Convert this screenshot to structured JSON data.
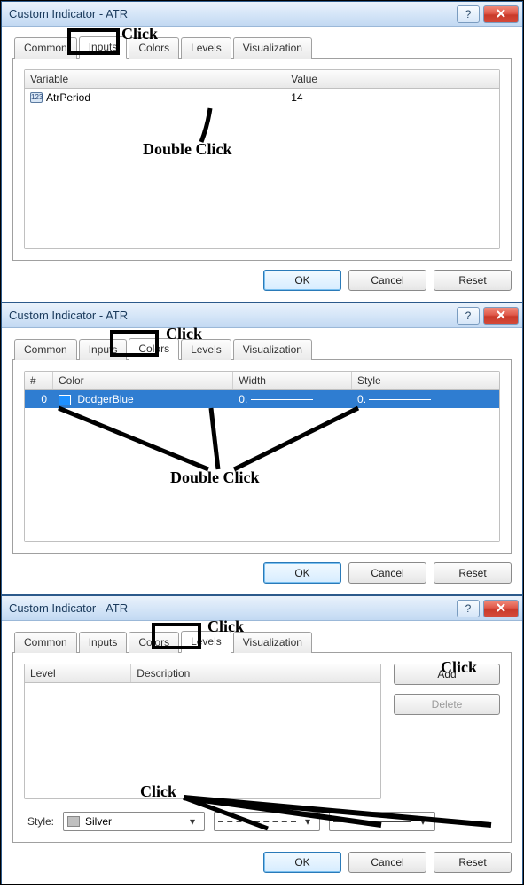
{
  "annotations": {
    "click": "Click",
    "double_click": "Double Click"
  },
  "dialogs": [
    {
      "title": "Custom Indicator - ATR",
      "tabs": [
        "Common",
        "Inputs",
        "Colors",
        "Levels",
        "Visualization"
      ],
      "active_tab": "Inputs",
      "inputs_table": {
        "columns": [
          "Variable",
          "Value"
        ],
        "rows": [
          {
            "icon": "int",
            "variable": "AtrPeriod",
            "value": "14"
          }
        ]
      },
      "buttons": {
        "ok": "OK",
        "cancel": "Cancel",
        "reset": "Reset"
      }
    },
    {
      "title": "Custom Indicator - ATR",
      "tabs": [
        "Common",
        "Inputs",
        "Colors",
        "Levels",
        "Visualization"
      ],
      "active_tab": "Colors",
      "colors_table": {
        "columns": [
          "#",
          "Color",
          "Width",
          "Style"
        ],
        "rows": [
          {
            "num": "0",
            "color": "DodgerBlue",
            "width": "0.",
            "style": "0."
          }
        ]
      },
      "buttons": {
        "ok": "OK",
        "cancel": "Cancel",
        "reset": "Reset"
      }
    },
    {
      "title": "Custom Indicator - ATR",
      "tabs": [
        "Common",
        "Inputs",
        "Colors",
        "Levels",
        "Visualization"
      ],
      "active_tab": "Levels",
      "levels_table": {
        "columns": [
          "Level",
          "Description"
        ]
      },
      "right_buttons": {
        "add": "Add",
        "delete": "Delete"
      },
      "style_row": {
        "label": "Style:",
        "color_name": "Silver"
      },
      "buttons": {
        "ok": "OK",
        "cancel": "Cancel",
        "reset": "Reset"
      }
    }
  ]
}
